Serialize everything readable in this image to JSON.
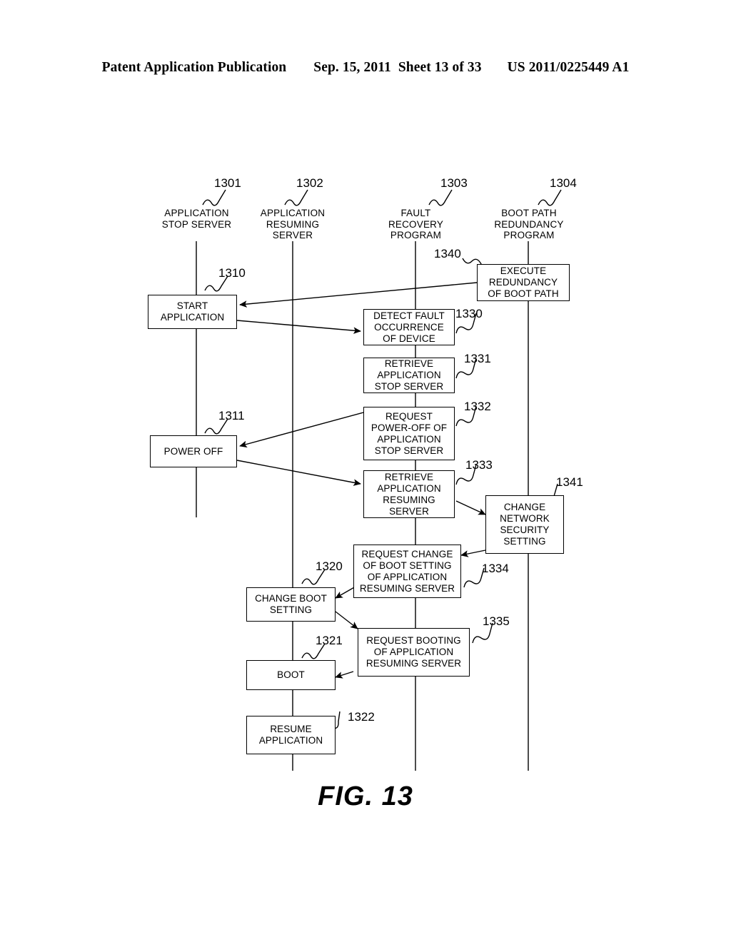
{
  "header": {
    "publication": "Patent Application Publication",
    "date": "Sep. 15, 2011",
    "sheet": "Sheet 13 of 33",
    "patent_number": "US 2011/0225449 A1"
  },
  "figure": {
    "caption": "FIG. 13",
    "lanes": [
      {
        "ref": "1301",
        "label": "APPLICATION\nSTOP SERVER"
      },
      {
        "ref": "1302",
        "label": "APPLICATION\nRESUMING\nSERVER"
      },
      {
        "ref": "1303",
        "label": "FAULT\nRECOVERY\nPROGRAM"
      },
      {
        "ref": "1304",
        "label": "BOOT PATH\nREDUNDANCY\nPROGRAM"
      }
    ],
    "nodes": [
      {
        "ref": "1310",
        "label": "START\nAPPLICATION"
      },
      {
        "ref": "1311",
        "label": "POWER OFF"
      },
      {
        "ref": "1320",
        "label": "CHANGE BOOT\nSETTING"
      },
      {
        "ref": "1321",
        "label": "BOOT"
      },
      {
        "ref": "1322",
        "label": "RESUME\nAPPLICATION"
      },
      {
        "ref": "1330",
        "label": "DETECT FAULT\nOCCURRENCE\nOF DEVICE"
      },
      {
        "ref": "1331",
        "label": "RETRIEVE\nAPPLICATION\nSTOP SERVER"
      },
      {
        "ref": "1332",
        "label": "REQUEST\nPOWER-OFF OF\nAPPLICATION\nSTOP SERVER"
      },
      {
        "ref": "1333",
        "label": "RETRIEVE\nAPPLICATION\nRESUMING\nSERVER"
      },
      {
        "ref": "1334",
        "label": "REQUEST CHANGE\nOF BOOT SETTING\nOF APPLICATION\nRESUMING SERVER"
      },
      {
        "ref": "1335",
        "label": "REQUEST BOOTING\nOF APPLICATION\nRESUMING SERVER"
      },
      {
        "ref": "1340",
        "label": "EXECUTE\nREDUNDANCY\nOF BOOT PATH"
      },
      {
        "ref": "1341",
        "label": "CHANGE\nNETWORK\nSECURITY\nSETTING"
      }
    ],
    "colors": {
      "line": "#000000",
      "fill": "#ffffff"
    }
  }
}
